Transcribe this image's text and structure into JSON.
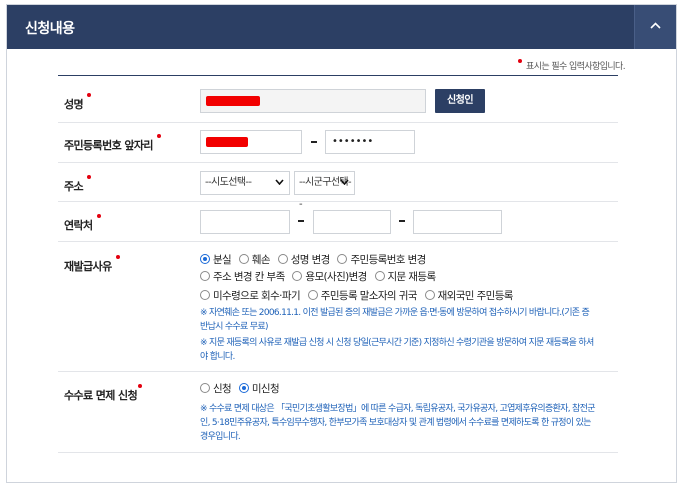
{
  "panel": {
    "title": "신청내용",
    "collapse_icon": "chevron-up-icon"
  },
  "required_note": "표시는 필수 입력사항입니다.",
  "name": {
    "label": "성명",
    "value": "",
    "button": "신청인"
  },
  "rrn": {
    "label": "주민등록번호 앞자리",
    "front_value": "",
    "back_value": "•••••••"
  },
  "address": {
    "label": "주소",
    "sido_selected": "--시도선택--",
    "sigungu_selected": "--시군구선택--"
  },
  "contact": {
    "label": "연락처",
    "part1": "",
    "part2": "",
    "part3": ""
  },
  "reissue": {
    "label": "재발급사유",
    "options_row1": [
      "분실",
      "훼손",
      "성명 변경",
      "주민등록번호 변경"
    ],
    "options_row2": [
      "주소 변경 칸 부족",
      "용모(사진)변경",
      "지문 재등록"
    ],
    "options_row3": [
      "미수령으로 회수·파기",
      "주민등록 말소자의 귀국",
      "재외국민 주민등록"
    ],
    "selected": "분실",
    "note1_line1": "※ 자연훼손 또는 2006.11.1. 이전 발급된 증의 재발급은 가까운 읍·면·동에 방문하여 접수하시기 바랍니다.(기존 증",
    "note1_line2": "반납시 수수료 무료)",
    "note2_line1": "※ 지문 재등록의 사유로 재발급 신청 시 신청 당일(근무시간 기준) 지정하신 수령기관을 방문하여 지문 재등록을 하셔",
    "note2_line2": "야 합니다."
  },
  "fee": {
    "label": "수수료 면제 신청",
    "options": [
      "신청",
      "미신청"
    ],
    "selected": "미신청",
    "note_line1": "※ 수수료 면제 대상은 「국민기초생활보장법」에 따른 수급자, 독립유공자, 국가유공자, 고엽제후유의증환자, 참전군",
    "note_line2": "인, 5·18민주유공자, 특수임무수행자, 한부모가족 보호대상자 및 관계 법령에서 수수료를 면제하도록 한 규정이 있는",
    "note_line3": "경우입니다."
  },
  "colors": {
    "header": "#2c3f64",
    "required": "#e3000f",
    "note": "#1f62b8",
    "radio_on": "#1b6ad8"
  }
}
